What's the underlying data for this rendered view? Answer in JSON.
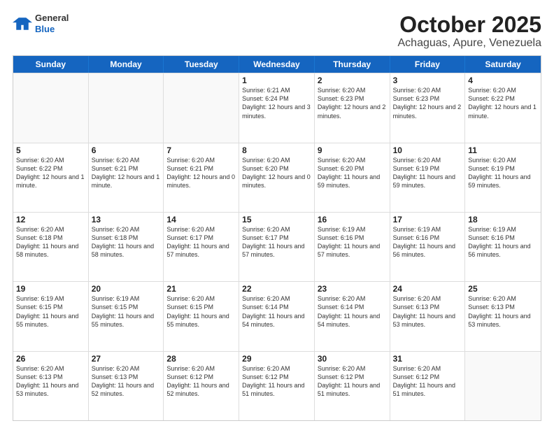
{
  "header": {
    "logo": {
      "general": "General",
      "blue": "Blue"
    },
    "title": "October 2025",
    "subtitle": "Achaguas, Apure, Venezuela"
  },
  "days_of_week": [
    "Sunday",
    "Monday",
    "Tuesday",
    "Wednesday",
    "Thursday",
    "Friday",
    "Saturday"
  ],
  "weeks": [
    [
      {
        "day": "",
        "info": ""
      },
      {
        "day": "",
        "info": ""
      },
      {
        "day": "",
        "info": ""
      },
      {
        "day": "1",
        "info": "Sunrise: 6:21 AM\nSunset: 6:24 PM\nDaylight: 12 hours and 3 minutes."
      },
      {
        "day": "2",
        "info": "Sunrise: 6:20 AM\nSunset: 6:23 PM\nDaylight: 12 hours and 2 minutes."
      },
      {
        "day": "3",
        "info": "Sunrise: 6:20 AM\nSunset: 6:23 PM\nDaylight: 12 hours and 2 minutes."
      },
      {
        "day": "4",
        "info": "Sunrise: 6:20 AM\nSunset: 6:22 PM\nDaylight: 12 hours and 1 minute."
      }
    ],
    [
      {
        "day": "5",
        "info": "Sunrise: 6:20 AM\nSunset: 6:22 PM\nDaylight: 12 hours and 1 minute."
      },
      {
        "day": "6",
        "info": "Sunrise: 6:20 AM\nSunset: 6:21 PM\nDaylight: 12 hours and 1 minute."
      },
      {
        "day": "7",
        "info": "Sunrise: 6:20 AM\nSunset: 6:21 PM\nDaylight: 12 hours and 0 minutes."
      },
      {
        "day": "8",
        "info": "Sunrise: 6:20 AM\nSunset: 6:20 PM\nDaylight: 12 hours and 0 minutes."
      },
      {
        "day": "9",
        "info": "Sunrise: 6:20 AM\nSunset: 6:20 PM\nDaylight: 11 hours and 59 minutes."
      },
      {
        "day": "10",
        "info": "Sunrise: 6:20 AM\nSunset: 6:19 PM\nDaylight: 11 hours and 59 minutes."
      },
      {
        "day": "11",
        "info": "Sunrise: 6:20 AM\nSunset: 6:19 PM\nDaylight: 11 hours and 59 minutes."
      }
    ],
    [
      {
        "day": "12",
        "info": "Sunrise: 6:20 AM\nSunset: 6:18 PM\nDaylight: 11 hours and 58 minutes."
      },
      {
        "day": "13",
        "info": "Sunrise: 6:20 AM\nSunset: 6:18 PM\nDaylight: 11 hours and 58 minutes."
      },
      {
        "day": "14",
        "info": "Sunrise: 6:20 AM\nSunset: 6:17 PM\nDaylight: 11 hours and 57 minutes."
      },
      {
        "day": "15",
        "info": "Sunrise: 6:20 AM\nSunset: 6:17 PM\nDaylight: 11 hours and 57 minutes."
      },
      {
        "day": "16",
        "info": "Sunrise: 6:19 AM\nSunset: 6:16 PM\nDaylight: 11 hours and 57 minutes."
      },
      {
        "day": "17",
        "info": "Sunrise: 6:19 AM\nSunset: 6:16 PM\nDaylight: 11 hours and 56 minutes."
      },
      {
        "day": "18",
        "info": "Sunrise: 6:19 AM\nSunset: 6:16 PM\nDaylight: 11 hours and 56 minutes."
      }
    ],
    [
      {
        "day": "19",
        "info": "Sunrise: 6:19 AM\nSunset: 6:15 PM\nDaylight: 11 hours and 55 minutes."
      },
      {
        "day": "20",
        "info": "Sunrise: 6:19 AM\nSunset: 6:15 PM\nDaylight: 11 hours and 55 minutes."
      },
      {
        "day": "21",
        "info": "Sunrise: 6:20 AM\nSunset: 6:15 PM\nDaylight: 11 hours and 55 minutes."
      },
      {
        "day": "22",
        "info": "Sunrise: 6:20 AM\nSunset: 6:14 PM\nDaylight: 11 hours and 54 minutes."
      },
      {
        "day": "23",
        "info": "Sunrise: 6:20 AM\nSunset: 6:14 PM\nDaylight: 11 hours and 54 minutes."
      },
      {
        "day": "24",
        "info": "Sunrise: 6:20 AM\nSunset: 6:13 PM\nDaylight: 11 hours and 53 minutes."
      },
      {
        "day": "25",
        "info": "Sunrise: 6:20 AM\nSunset: 6:13 PM\nDaylight: 11 hours and 53 minutes."
      }
    ],
    [
      {
        "day": "26",
        "info": "Sunrise: 6:20 AM\nSunset: 6:13 PM\nDaylight: 11 hours and 53 minutes."
      },
      {
        "day": "27",
        "info": "Sunrise: 6:20 AM\nSunset: 6:13 PM\nDaylight: 11 hours and 52 minutes."
      },
      {
        "day": "28",
        "info": "Sunrise: 6:20 AM\nSunset: 6:12 PM\nDaylight: 11 hours and 52 minutes."
      },
      {
        "day": "29",
        "info": "Sunrise: 6:20 AM\nSunset: 6:12 PM\nDaylight: 11 hours and 51 minutes."
      },
      {
        "day": "30",
        "info": "Sunrise: 6:20 AM\nSunset: 6:12 PM\nDaylight: 11 hours and 51 minutes."
      },
      {
        "day": "31",
        "info": "Sunrise: 6:20 AM\nSunset: 6:12 PM\nDaylight: 11 hours and 51 minutes."
      },
      {
        "day": "",
        "info": ""
      }
    ]
  ]
}
